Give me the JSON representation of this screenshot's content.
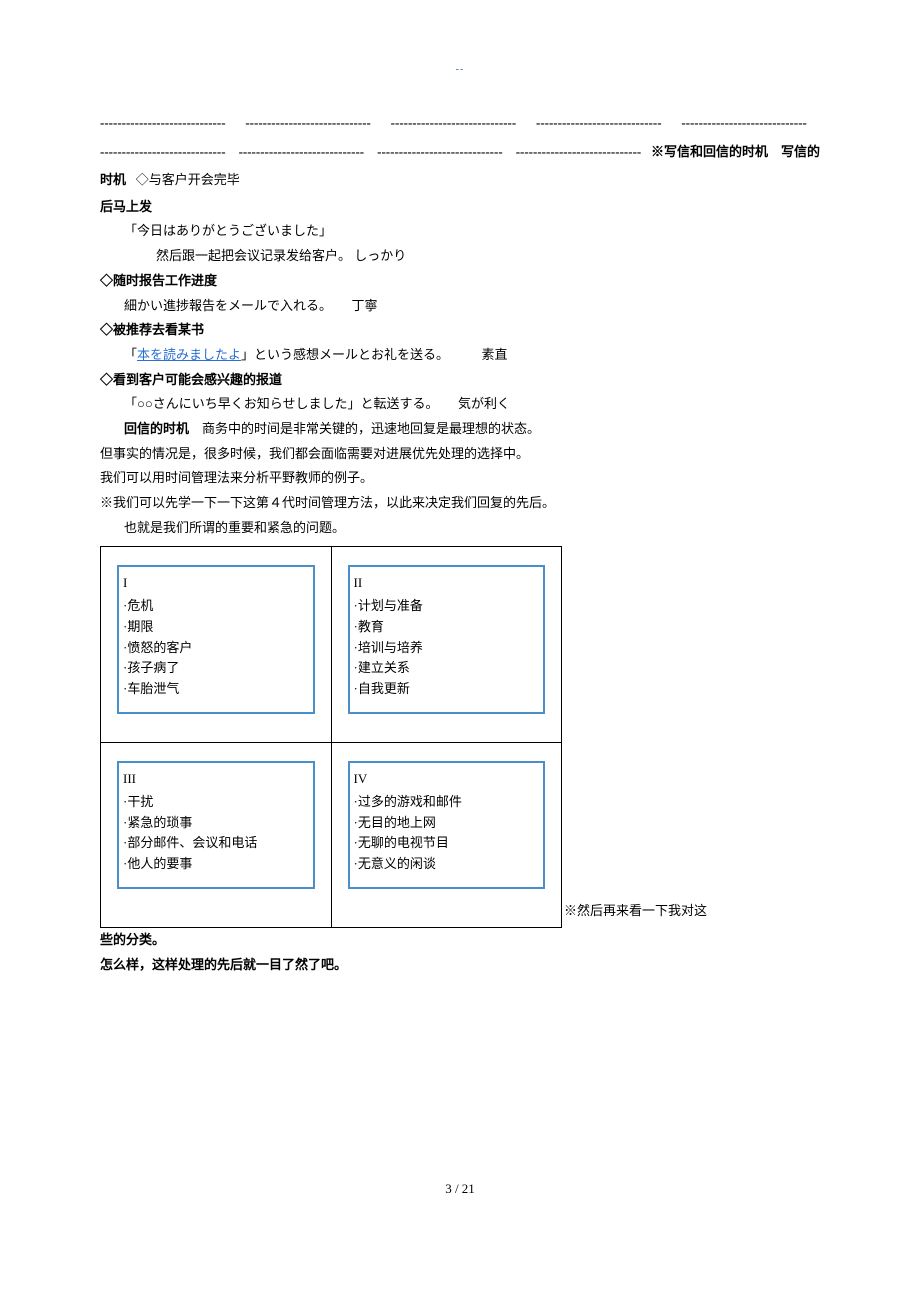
{
  "header_dashes": "--",
  "dash_segment": "-----------------------------",
  "dash_short1": "------",
  "dash_short2": "--------------",
  "dash_short3": "--------------",
  "topic": "※写信和回信的时机　写信的时机",
  "p_after_topic": "◇与客户开会完毕",
  "p_mashangfa": "后马上发",
  "jp_thanks": "「今日はありがとうございました」",
  "then_send": "然后跟一起把会议记录发给客户。  しっかり",
  "progress_head": "◇随时报告工作进度",
  "progress_jp": "細かい進捗報告をメールで入れる。　　丁寧",
  "book_head": "◇被推荐去看某书",
  "book_jp_pre": "「",
  "book_link": "本を読みましたよ",
  "book_jp_post": "」という感想メールとお礼を送る。　　　素直",
  "interest_head": "◇看到客户可能会感兴趣的报道",
  "interest_jp": "「○○さんにいち早くお知らせしました」と転送する。　　気が利く",
  "reply_heading": "回信的时机",
  "reply_line1": "商务中的时间是非常关键的，迅速地回复是最理想的状态。",
  "reply_line2": "但事实的情况是，很多时候，我们都会面临需要对进展优先处理的选择中。",
  "reply_line3": "我们可以用时间管理法来分析平野教师的例子。",
  "method_line": "※我们可以先学一下一下这第４代时间管理方法，以此来决定我们回复的先后。",
  "method_line2": "也就是我们所谓的重要和紧急的问题。",
  "quad": {
    "q1": {
      "roman": "I",
      "items": [
        "·危机",
        "·期限",
        "·愤怒的客户",
        "·孩子病了",
        "·车胎泄气"
      ]
    },
    "q2": {
      "roman": "II",
      "items": [
        "·计划与准备",
        "·教育",
        "·培训与培养",
        "·建立关系",
        "·自我更新"
      ]
    },
    "q3": {
      "roman": "III",
      "items": [
        "·干扰",
        "·紧急的琐事",
        "·部分邮件、会议和电话",
        "·他人的要事"
      ]
    },
    "q4": {
      "roman": "IV",
      "items": [
        "·过多的游戏和邮件",
        "·无目的地上网",
        "·无聊的电视节目",
        "·无意义的闲谈"
      ]
    }
  },
  "after_quad": "※然后再来看一下我对这",
  "after_quad2": "些的分类。",
  "after_quad3": "怎么样，这样处理的先后就一目了然了吧。",
  "footer": "3 / 21"
}
